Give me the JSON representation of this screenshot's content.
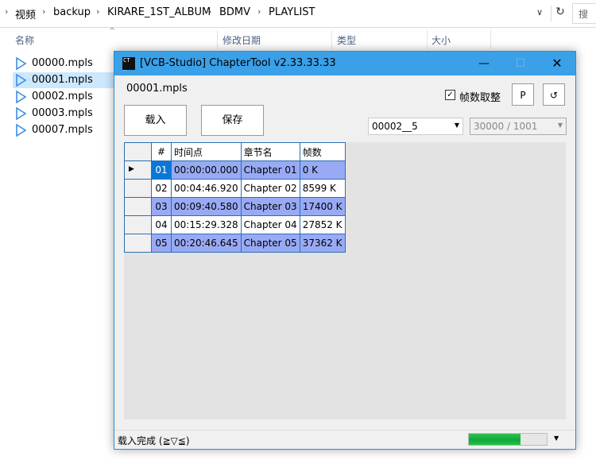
{
  "explorer": {
    "breadcrumb": [
      "视频",
      "backup",
      "KIRARE_1ST_ALBUM",
      "BDMV",
      "PLAYLIST"
    ],
    "search_placeholder": "搜",
    "columns": {
      "name": "名称",
      "modified": "修改日期",
      "type": "类型",
      "size": "大小"
    },
    "files": [
      "00000.mpls",
      "00001.mpls",
      "00002.mpls",
      "00003.mpls",
      "00007.mpls"
    ],
    "selected_file": "00001.mpls"
  },
  "app": {
    "title": "[VCB-Studio] ChapterTool v2.33.33.33",
    "icon_text": "CT",
    "file_label": "00001.mpls",
    "frame_round": {
      "label": "帧数取整",
      "checked": true
    },
    "buttons": {
      "load": "载入",
      "save": "保存",
      "p": "P",
      "refresh_icon": "refresh-icon"
    },
    "playlist_combo": "00002__5",
    "framerate_combo": "30000 / 1001",
    "table": {
      "headers": [
        "#",
        "时间点",
        "章节名",
        "帧数"
      ],
      "rows": [
        {
          "num": "01",
          "time": "00:00:00.000",
          "name": "Chapter 01",
          "frames": "0 K"
        },
        {
          "num": "02",
          "time": "00:04:46.920",
          "name": "Chapter 02",
          "frames": "8599 K"
        },
        {
          "num": "03",
          "time": "00:09:40.580",
          "name": "Chapter 03",
          "frames": "17400 K"
        },
        {
          "num": "04",
          "time": "00:15:29.328",
          "name": "Chapter 04",
          "frames": "27852 K"
        },
        {
          "num": "05",
          "time": "00:20:46.645",
          "name": "Chapter 05",
          "frames": "37362 K"
        }
      ]
    },
    "status": "载入完成 (≧▽≦)",
    "progress_fraction": 0.66,
    "colors": {
      "titlebar": "#3aa0e8",
      "row_highlight": "#99aaf5",
      "selected_cell": "#0a78d7",
      "progress": "#12a83a"
    }
  }
}
